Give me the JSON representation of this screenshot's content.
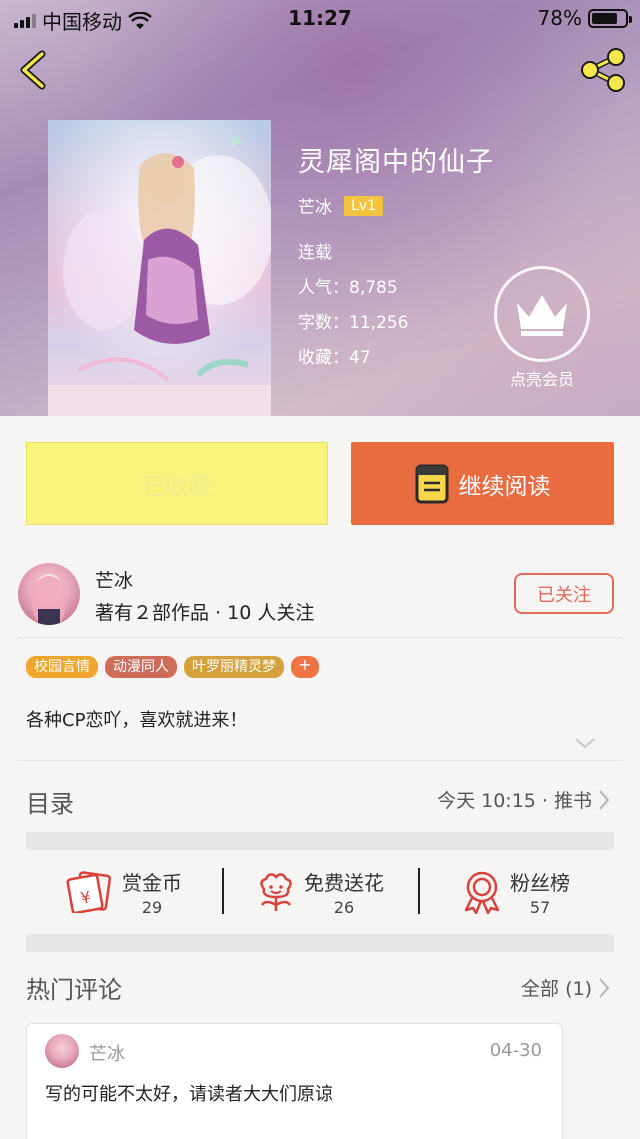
{
  "status_bar": {
    "carrier": "中国移动",
    "time": "11:27",
    "battery": "78%",
    "battery_level": 0.78
  },
  "book": {
    "title": "灵犀阁中的仙子",
    "author": "芒冰",
    "level": "Lv1",
    "status": "连载",
    "popularity_label": "人气：",
    "popularity": "8,785",
    "words_label": "字数：",
    "words": "11,256",
    "favorites_label": "收藏：",
    "favorites": "47"
  },
  "vip": {
    "label": "点亮会员"
  },
  "buttons": {
    "collected": "已收藏",
    "continue_reading": "继续阅读"
  },
  "author_card": {
    "name": "芒冰",
    "meta": "著有２部作品 · 10 人关注",
    "follow": "已关注"
  },
  "tags": [
    {
      "label": "校园言情",
      "color": "#f0a52d"
    },
    {
      "label": "动漫同人",
      "color": "#cf6d5b"
    },
    {
      "label": "叶罗丽精灵梦",
      "color": "#d4a13c"
    },
    {
      "label": "+",
      "color": "#ef7343"
    }
  ],
  "description": "各种CP恋吖，喜欢就进来！",
  "toc": {
    "label": "目录",
    "updated": "今天 10:15 · 推书"
  },
  "actions": [
    {
      "name": "赏金币",
      "count": "29",
      "icon": "red-envelope-icon"
    },
    {
      "name": "免费送花",
      "count": "26",
      "icon": "flower-icon"
    },
    {
      "name": "粉丝榜",
      "count": "57",
      "icon": "medal-icon"
    }
  ],
  "hot_comments": {
    "label": "热门评论",
    "all": "全部 (1)"
  },
  "comment": {
    "author": "芒冰",
    "date": "04-30",
    "text": "写的可能不太好，请读者大大们原谅"
  },
  "colors": {
    "accent": "#e96c41",
    "collect_bg": "#fbf47c",
    "follow": "#e36a5a",
    "icon_red": "#d8423a"
  }
}
